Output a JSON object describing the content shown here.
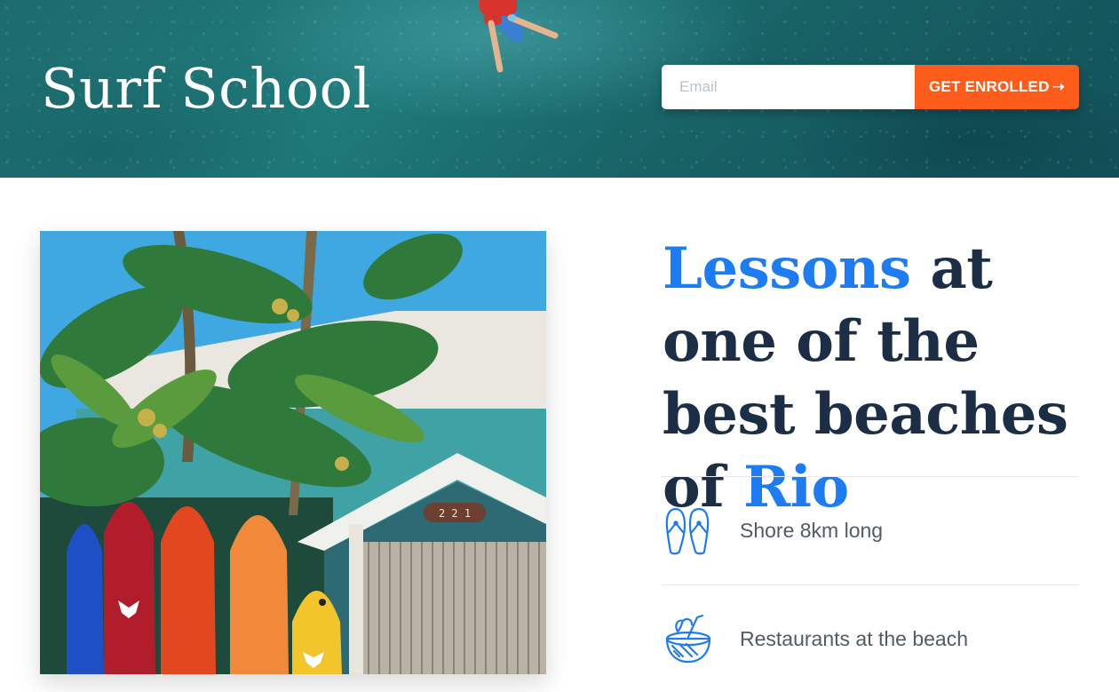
{
  "header": {
    "brand": "Surf School",
    "email_placeholder": "Email",
    "enroll_label": "GET ENROLLED",
    "enroll_arrow": "➝"
  },
  "headline": {
    "part1": "Lessons",
    "part2": " at one of the best beaches of ",
    "part3": "Rio"
  },
  "features": [
    {
      "icon": "flip-flops-icon",
      "label": "Shore 8km long"
    },
    {
      "icon": "coconut-drink-icon",
      "label": "Restaurants at the beach"
    }
  ],
  "colors": {
    "accent": "#1d7cf2",
    "cta": "#fe5c1a",
    "heading": "#1c2e45",
    "body_text": "#505c69"
  }
}
